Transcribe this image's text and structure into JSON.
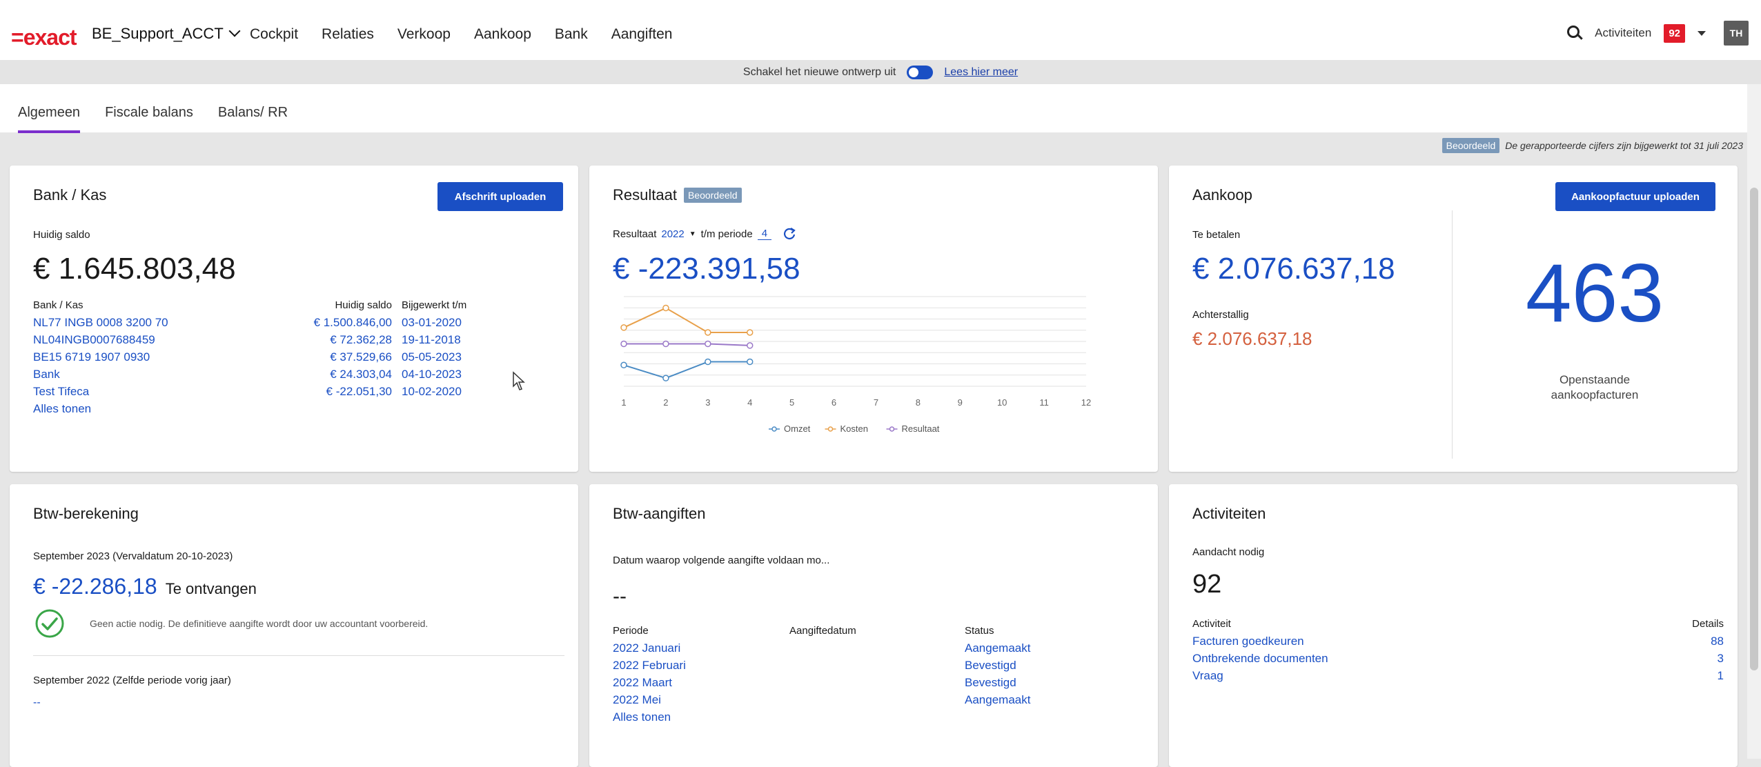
{
  "header": {
    "logo": "=exact",
    "admin": "BE_Support_ACCT",
    "nav": [
      "Cockpit",
      "Relaties",
      "Verkoop",
      "Aankoop",
      "Bank",
      "Aangiften"
    ],
    "activities_label": "Activiteiten",
    "activities_count": "92",
    "avatar": "TH"
  },
  "design_bar": {
    "text": "Schakel het nieuwe ontwerp uit",
    "link": "Lees hier meer"
  },
  "tabs": [
    "Algemeen",
    "Fiscale balans",
    "Balans/ RR"
  ],
  "status": {
    "badge": "Beoordeeld",
    "text": "De gerapporteerde cijfers zijn bijgewerkt tot 31 juli 2023"
  },
  "bank": {
    "title": "Bank / Kas",
    "button": "Afschrift uploaden",
    "current_balance_label": "Huidig saldo",
    "current_balance": "€ 1.645.803,48",
    "col_account": "Bank / Kas",
    "col_balance": "Huidig saldo",
    "col_updated": "Bijgewerkt t/m",
    "rows": [
      {
        "account": "NL77 INGB 0008 3200 70",
        "balance": "€ 1.500.846,00",
        "updated": "03-01-2020"
      },
      {
        "account": "NL04INGB0007688459",
        "balance": "€ 72.362,28",
        "updated": "19-11-2018"
      },
      {
        "account": "BE15 6719 1907 0930",
        "balance": "€ 37.529,66",
        "updated": "05-05-2023"
      },
      {
        "account": "Bank",
        "balance": "€ 24.303,04",
        "updated": "04-10-2023"
      },
      {
        "account": "Test Tifeca",
        "balance": "€ -22.051,30",
        "updated": "10-02-2020"
      }
    ],
    "show_all": "Alles tonen"
  },
  "result": {
    "title": "Resultaat",
    "badge": "Beoordeeld",
    "filter_label": "Resultaat",
    "year": "2022",
    "period_label": "t/m periode",
    "period": "4",
    "amount": "€ -223.391,58"
  },
  "chart_data": {
    "type": "line",
    "x": [
      1,
      2,
      3,
      4,
      5,
      6,
      7,
      8,
      9,
      10,
      11,
      12
    ],
    "series": [
      {
        "name": "Omzet",
        "color": "#4a8bc4",
        "values": [
          -0.2,
          -1.0,
          0.0,
          0.0,
          null,
          null,
          null,
          null,
          null,
          null,
          null,
          null
        ]
      },
      {
        "name": "Kosten",
        "color": "#e8a04a",
        "values": [
          2.1,
          3.3,
          1.8,
          1.8,
          null,
          null,
          null,
          null,
          null,
          null,
          null,
          null
        ]
      },
      {
        "name": "Resultaat",
        "color": "#9a78c8",
        "values": [
          1.1,
          1.1,
          1.1,
          1.0,
          null,
          null,
          null,
          null,
          null,
          null,
          null,
          null
        ]
      }
    ],
    "xlabels": [
      "1",
      "2",
      "3",
      "4",
      "5",
      "6",
      "7",
      "8",
      "9",
      "10",
      "11",
      "12"
    ],
    "ylim": [
      -1.5,
      4
    ],
    "grid": true,
    "legend": "bottom"
  },
  "purchase": {
    "title": "Aankoop",
    "button": "Aankoopfactuur uploaden",
    "to_pay_label": "Te betalen",
    "to_pay": "€ 2.076.637,18",
    "overdue_label": "Achterstallig",
    "overdue": "€ 2.076.637,18",
    "open_count": "463",
    "open_label_1": "Openstaande",
    "open_label_2": "aankoopfacturen"
  },
  "vat_calc": {
    "title": "Btw-berekening",
    "period": "September 2023 (Vervaldatum 20-10-2023)",
    "amount": "€ -22.286,18",
    "amount_suffix": "Te ontvangen",
    "note": "Geen actie nodig. De definitieve aangifte wordt door uw accountant voorbereid.",
    "prev_period": "September 2022 (Zelfde periode vorig jaar)",
    "prev_amount": "--"
  },
  "vat_returns": {
    "title": "Btw-aangiften",
    "subtitle": "Datum waarop volgende aangifte voldaan mo...",
    "next_date": "--",
    "col_period": "Periode",
    "col_date": "Aangiftedatum",
    "col_status": "Status",
    "rows": [
      {
        "period": "2022 Januari",
        "date": "",
        "status": "Aangemaakt"
      },
      {
        "period": "2022 Februari",
        "date": "",
        "status": "Bevestigd"
      },
      {
        "period": "2022 Maart",
        "date": "",
        "status": "Bevestigd"
      },
      {
        "period": "2022 Mei",
        "date": "",
        "status": "Aangemaakt"
      }
    ],
    "show_all": "Alles tonen"
  },
  "activities": {
    "title": "Activiteiten",
    "attention_label": "Aandacht nodig",
    "attention_count": "92",
    "col_activity": "Activiteit",
    "col_details": "Details",
    "rows": [
      {
        "name": "Facturen goedkeuren",
        "count": "88"
      },
      {
        "name": "Ontbrekende documenten",
        "count": "3"
      },
      {
        "name": "Vraag",
        "count": "1"
      }
    ]
  }
}
